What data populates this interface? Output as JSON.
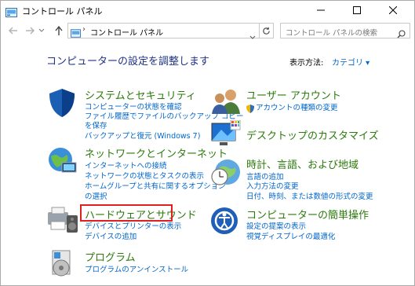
{
  "window": {
    "title": "コントロール パネル"
  },
  "nav": {
    "breadcrumb_root": "›",
    "address": "コントロール パネル",
    "search_placeholder": "コントロール パネルの検索"
  },
  "main": {
    "heading": "コンピューターの設定を調整します",
    "view_by_label": "表示方法:",
    "view_by_value": "カテゴリ ▾"
  },
  "categories": {
    "system": {
      "title": "システムとセキュリティ",
      "links": [
        "コンピューターの状態を確認",
        "ファイル履歴でファイルのバックアップ コピー",
        "を保存",
        "バックアップと復元 (Windows 7)"
      ]
    },
    "network": {
      "title": "ネットワークとインターネット",
      "links": [
        "インターネットへの接続",
        "ネットワークの状態とタスクの表示",
        "ホームグループと共有に関するオプション",
        "の選択"
      ]
    },
    "hardware": {
      "title": "ハードウェアとサウンド",
      "links": [
        "デバイスとプリンターの表示",
        "デバイスの追加"
      ]
    },
    "programs": {
      "title": "プログラム",
      "links": [
        "プログラムのアンインストール"
      ]
    },
    "users": {
      "title": "ユーザー アカウント",
      "links": [
        "アカウントの種類の変更"
      ]
    },
    "desktop": {
      "title": "デスクトップのカスタマイズ",
      "links": []
    },
    "clock": {
      "title": "時計、言語、および地域",
      "links": [
        "言語の追加",
        "入力方法の変更",
        "日付、時刻、または数値の形式の変更"
      ]
    },
    "ease": {
      "title": "コンピューターの簡単操作",
      "links": [
        "設定の提案の表示",
        "視覚ディスプレイの最適化"
      ]
    }
  }
}
